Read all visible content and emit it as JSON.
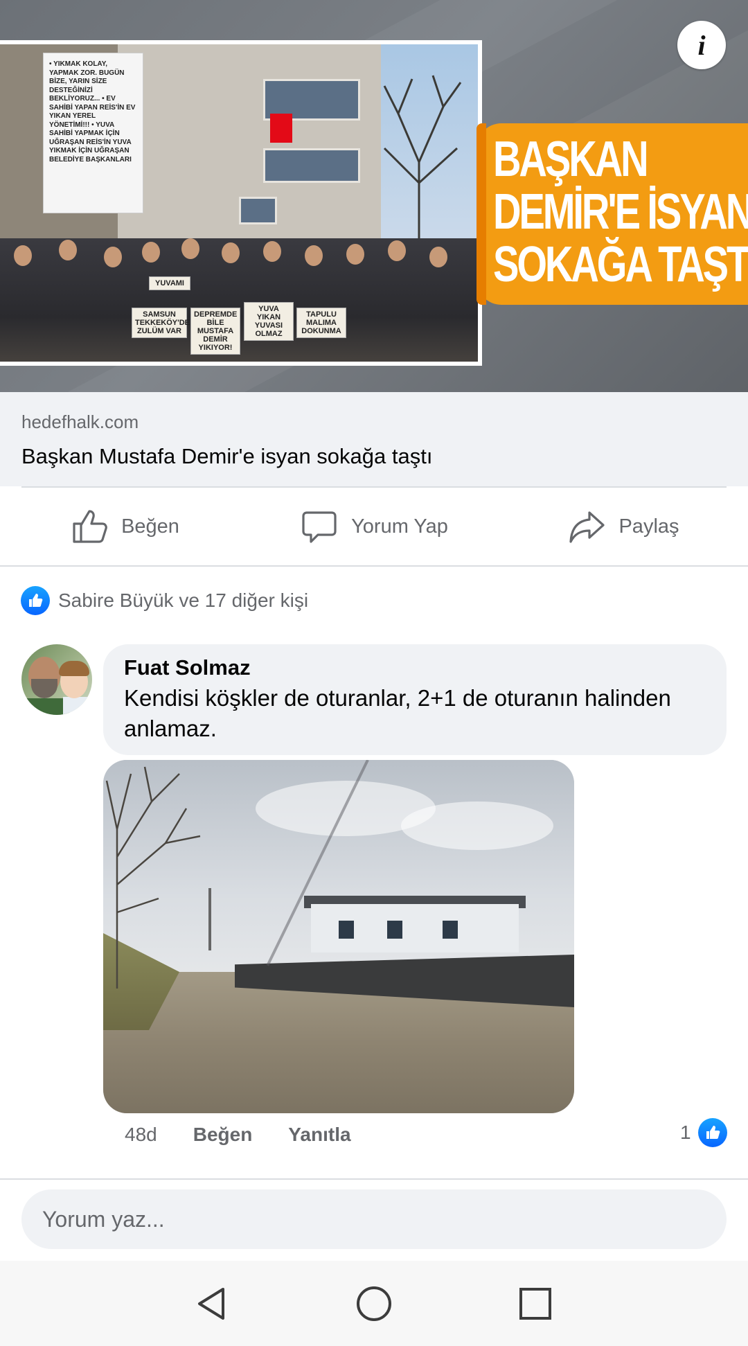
{
  "preview": {
    "banner_text": "• YIKMAK KOLAY, YAPMAK ZOR. BUGÜN BİZE, YARIN SİZE DESTEĞİNİZİ BEKLİYORUZ... • EV SAHİBİ YAPAN REİS'İN EV YIKAN YEREL YÖNETİMİ!!! • YUVA SAHİBİ YAPMAK İÇİN UĞRAŞAN REİS'İN YUVA YIKMAK İÇİN UĞRAŞAN BELEDİYE BAŞKANLARI",
    "signs": [
      "YUVAMI",
      "SAMSUN TEKKEKÖY'DE ZULÜM VAR",
      "DEPREMDE BİLE MUSTAFA DEMİR YIKIYOR!",
      "YUVA YIKAN YUVASI OLMAZ",
      "TAPULU MALIMA DOKUNMA"
    ],
    "headline_lines": [
      "BAŞKAN",
      "DEMİR'E İSYAN",
      "SOKAĞA TAŞTI"
    ],
    "info_icon": "info-icon",
    "headline_color": "#f39c12"
  },
  "link": {
    "domain": "hedefhalk.com",
    "title": "Başkan Mustafa Demir'e isyan sokağa taştı"
  },
  "actions": {
    "like": "Beğen",
    "comment": "Yorum Yap",
    "share": "Paylaş"
  },
  "reactions": {
    "summary": "Sabire Büyük ve 17 diğer kişi",
    "like_color": "#0866ff"
  },
  "comment": {
    "author": "Fuat Solmaz",
    "text": "Kendisi köşkler de oturanlar, 2+1 de oturanın halinden anlamaz.",
    "age": "48d",
    "like_label": "Beğen",
    "reply_label": "Yanıtla",
    "like_count": "1"
  },
  "composer": {
    "placeholder": "Yorum yaz..."
  },
  "navbar": {
    "back_icon": "back-triangle-icon",
    "home_icon": "home-circle-icon",
    "recents_icon": "recents-square-icon"
  }
}
